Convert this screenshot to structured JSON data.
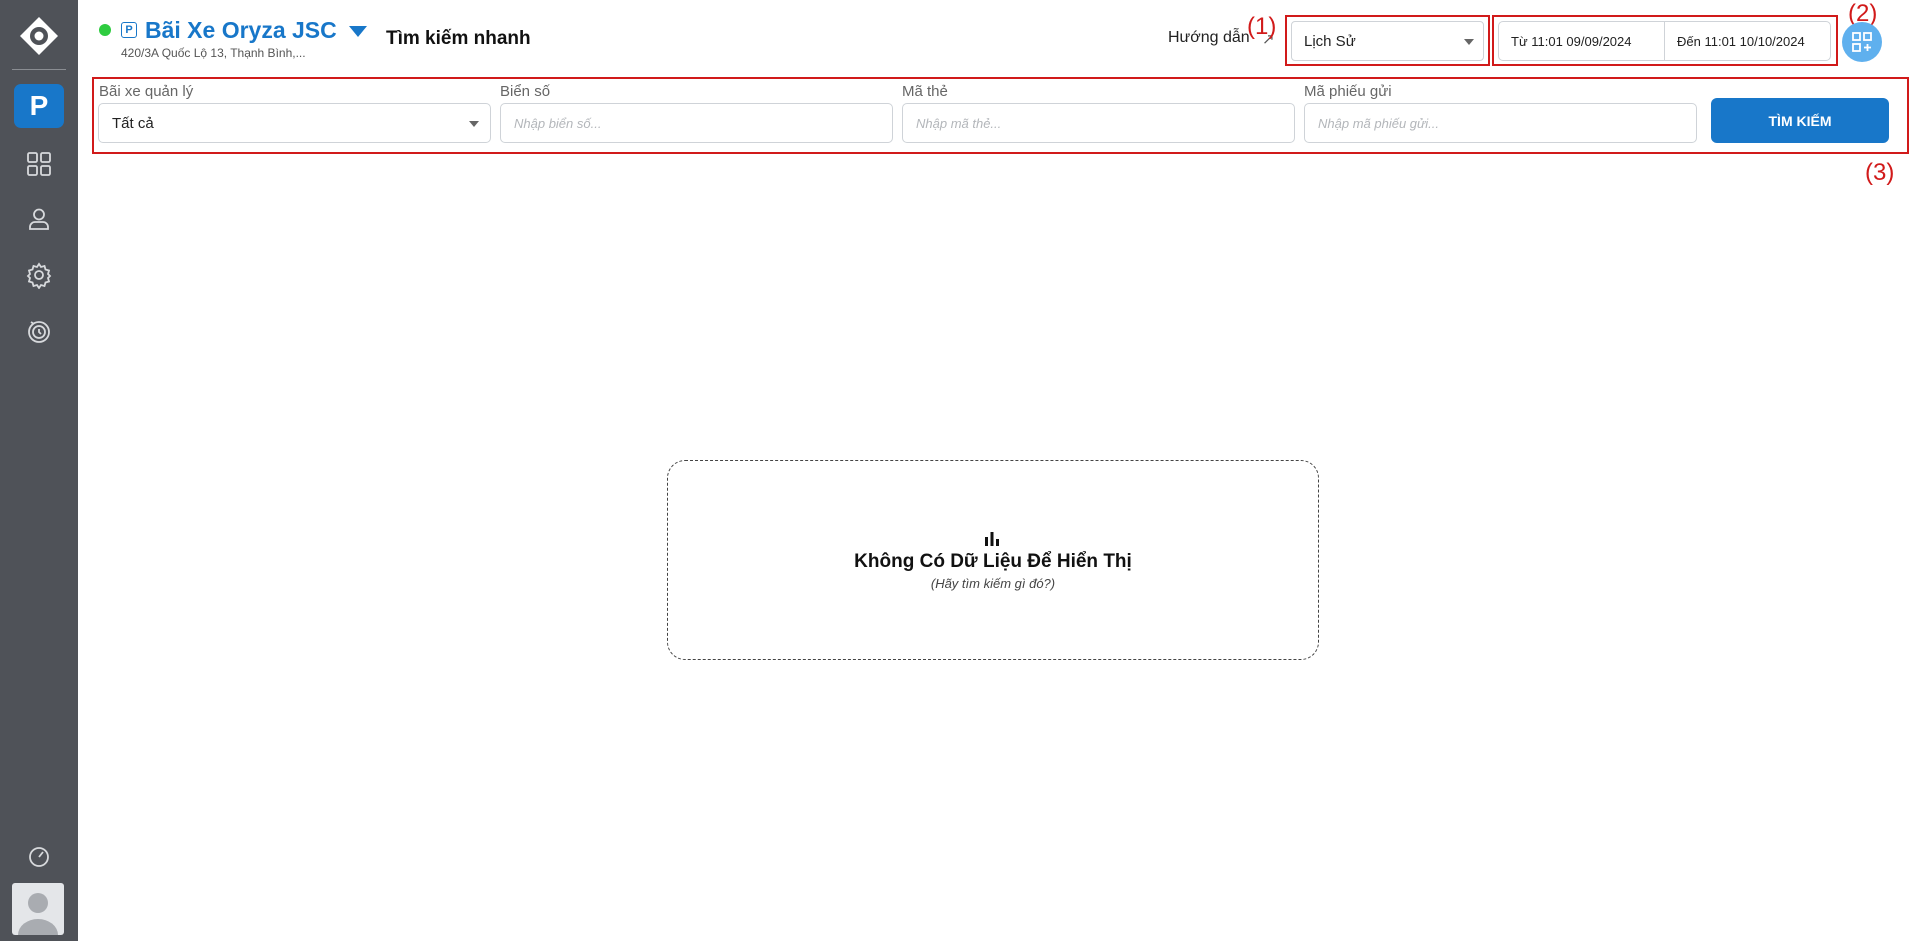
{
  "sidebar": {
    "brand_letter": "P",
    "nav_icons": [
      "dashboard-grid-icon",
      "user-icon",
      "gear-icon",
      "history-timer-icon"
    ],
    "bottom_icon": "speedometer-icon",
    "avatar_icon": "user-avatar-icon"
  },
  "header": {
    "status_color": "#2ecc40",
    "parking_icon_letter": "P",
    "title": "Bãi Xe Oryza JSC",
    "address": "420/3A Quốc Lộ 13, Thạnh Bình,...",
    "page_title": "Tìm kiếm nhanh",
    "guide_label": "Hướng dẫn",
    "guide_arrow": "↗",
    "mode_select_value": "Lịch Sử",
    "date_from": "Từ 11:01 09/09/2024",
    "date_to": "Đến 11:01 10/10/2024",
    "qr_icon": "qr-add-icon"
  },
  "annotations": {
    "a1": "(1)",
    "a2": "(2)",
    "a3": "(3)",
    "color": "#d11a1a"
  },
  "filters": {
    "parking_lot": {
      "label": "Bãi xe quản lý",
      "value": "Tất cả"
    },
    "plate": {
      "label": "Biển số",
      "placeholder": "Nhập biển số..."
    },
    "card": {
      "label": "Mã thẻ",
      "placeholder": "Nhập mã thẻ..."
    },
    "ticket": {
      "label": "Mã phiếu gửi",
      "placeholder": "Nhập mã phiếu gửi..."
    },
    "search_button": "TÌM KIẾM"
  },
  "empty_state": {
    "icon": "bar-chart-icon",
    "title": "Không Có Dữ Liệu Để Hiển Thị",
    "subtitle": "(Hãy tìm kiếm gì đó?)"
  },
  "colors": {
    "accent": "#1877c9",
    "sidebar_bg": "#4f5258",
    "qr_button": "#5fb0ee"
  }
}
